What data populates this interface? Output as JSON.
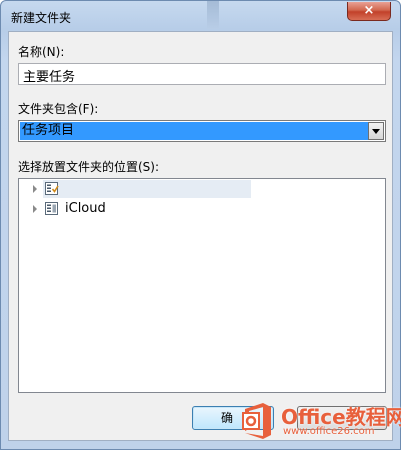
{
  "window": {
    "title": "新建文件夹",
    "close_symbol": "×"
  },
  "name_field": {
    "label": "名称(N):",
    "value": "主要任务"
  },
  "contains_field": {
    "label": "文件夹包含(F):",
    "selected": "任务项目"
  },
  "location": {
    "label": "选择放置文件夹的位置(S):",
    "items": [
      {
        "label": "",
        "icon": "task-folder-icon",
        "highlighted": true
      },
      {
        "label": "iCloud",
        "icon": "store-icon",
        "highlighted": false
      }
    ]
  },
  "buttons": {
    "ok_label": "确"
  },
  "watermark": {
    "title": "Office教程网",
    "url": "www.office26.com",
    "brand_color": "#e8603c"
  }
}
